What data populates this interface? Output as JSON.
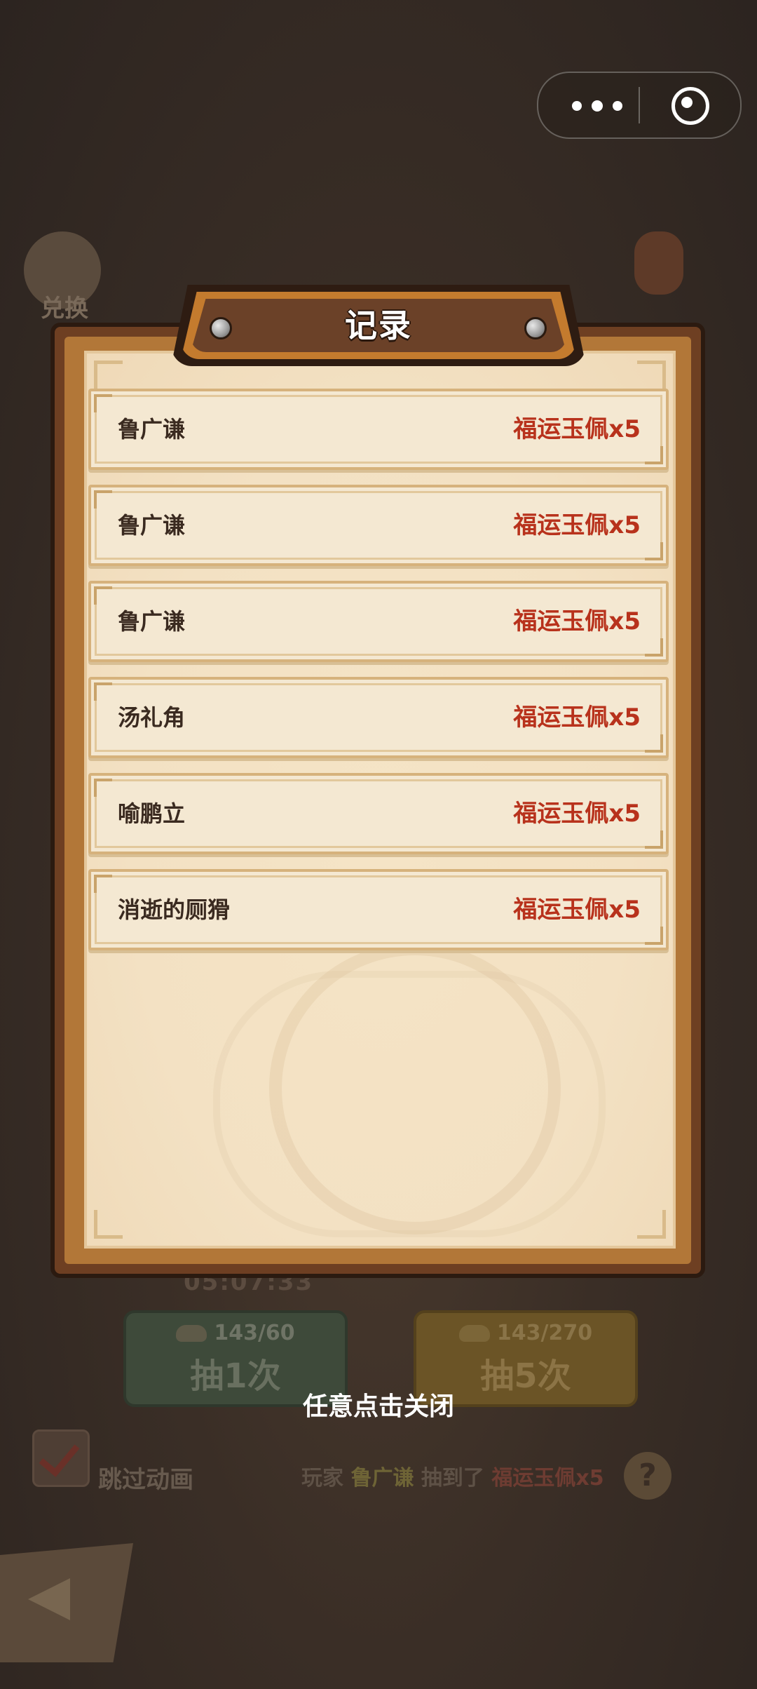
{
  "background": {
    "exchange_label": "兑换",
    "timer": "05:07:33",
    "draw_once": {
      "count": "143/60",
      "label": "抽1次"
    },
    "draw_five": {
      "count": "143/270",
      "label": "抽5次"
    },
    "skip_animation": "跳过动画",
    "ticker": {
      "prefix": "玩家",
      "player": "鲁广谦",
      "middle": "抽到了",
      "item": "福运玉佩x5"
    },
    "help_symbol": "?"
  },
  "dialog": {
    "title": "记录",
    "records": [
      {
        "name": "鲁广谦",
        "reward": "福运玉佩x5"
      },
      {
        "name": "鲁广谦",
        "reward": "福运玉佩x5"
      },
      {
        "name": "鲁广谦",
        "reward": "福运玉佩x5"
      },
      {
        "name": "汤礼角",
        "reward": "福运玉佩x5"
      },
      {
        "name": "喻鹏立",
        "reward": "福运玉佩x5"
      },
      {
        "name": "消逝的厕猾",
        "reward": "福运玉佩x5"
      }
    ],
    "close_hint": "任意点击关闭"
  },
  "capsule": {
    "more_icon": "more-dots-icon",
    "close_icon": "target-circle-icon"
  },
  "colors": {
    "reward_red": "#b8321c",
    "panel_wood": "#6e3f22",
    "paper": "#f3e1c3"
  }
}
